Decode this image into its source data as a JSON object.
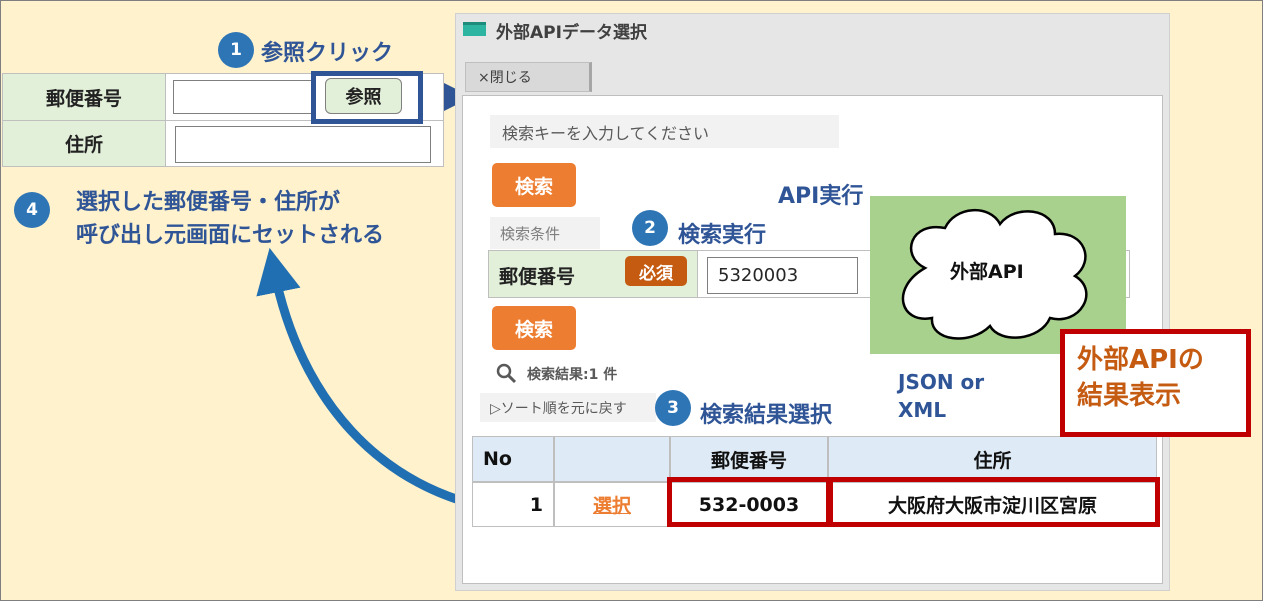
{
  "form": {
    "postal_label": "郵便番号",
    "address_label": "住所",
    "ref_button": "参照"
  },
  "steps": {
    "s1": {
      "num": "1",
      "text": "参照クリック"
    },
    "s2": {
      "num": "2",
      "text": "検索実行"
    },
    "s3": {
      "num": "3",
      "text": "検索結果選択"
    },
    "s4": {
      "num": "4",
      "line1": "選択した郵便番号・住所が",
      "line2": "呼び出し元画面にセットされる"
    }
  },
  "modal": {
    "title": "外部APIデータ選択",
    "close": "×閉じる",
    "search_key_placeholder": "検索キーを入力してください",
    "search_button": "検索",
    "conditions_label": "検索条件",
    "postal_label": "郵便番号",
    "required": "必須",
    "postal_value": "5320003",
    "search_button2": "検索",
    "result_count": "検索結果:1 件",
    "sort_reset": "▷ソート順を元に戻す"
  },
  "table": {
    "headers": [
      "No",
      "",
      "郵便番号",
      "住所"
    ],
    "rows": [
      {
        "no": "1",
        "select": "選択",
        "postal": "532-0003",
        "address": "大阪府大阪市淀川区宮原"
      }
    ]
  },
  "api": {
    "run_label": "API実行",
    "name": "外部API",
    "format_line1": "JSON or",
    "format_line2": "XML"
  },
  "callout": {
    "line1": "外部APIの",
    "line2": "結果表示"
  },
  "colors": {
    "background": "#fff2cc",
    "accent_blue": "#2e75b6",
    "orange": "#ed7d31",
    "red": "#c00000",
    "api_green": "#a9d18e"
  }
}
